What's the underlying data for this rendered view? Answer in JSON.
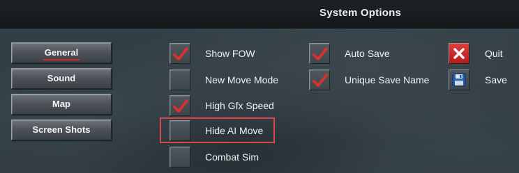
{
  "header": {
    "title": "System Options"
  },
  "nav": {
    "items": [
      {
        "label": "General",
        "active": true
      },
      {
        "label": "Sound",
        "active": false
      },
      {
        "label": "Map",
        "active": false
      },
      {
        "label": "Screen Shots",
        "active": false
      }
    ]
  },
  "options": {
    "left": [
      {
        "label": "Show FOW",
        "checked": true
      },
      {
        "label": "New Move Mode",
        "checked": false
      },
      {
        "label": "High Gfx Speed",
        "checked": true
      },
      {
        "label": "Hide AI Move",
        "checked": false
      },
      {
        "label": "Combat Sim",
        "checked": false
      }
    ],
    "right": [
      {
        "label": "Auto Save",
        "checked": true
      },
      {
        "label": "Unique Save Name",
        "checked": true
      }
    ]
  },
  "actions": {
    "quit": {
      "label": "Quit",
      "icon": "close-icon"
    },
    "save": {
      "label": "Save",
      "icon": "floppy-disk-icon"
    }
  },
  "colors": {
    "check": "#d8322f",
    "highlight": "#d9474a",
    "quit_bg": "#d12a2a"
  }
}
